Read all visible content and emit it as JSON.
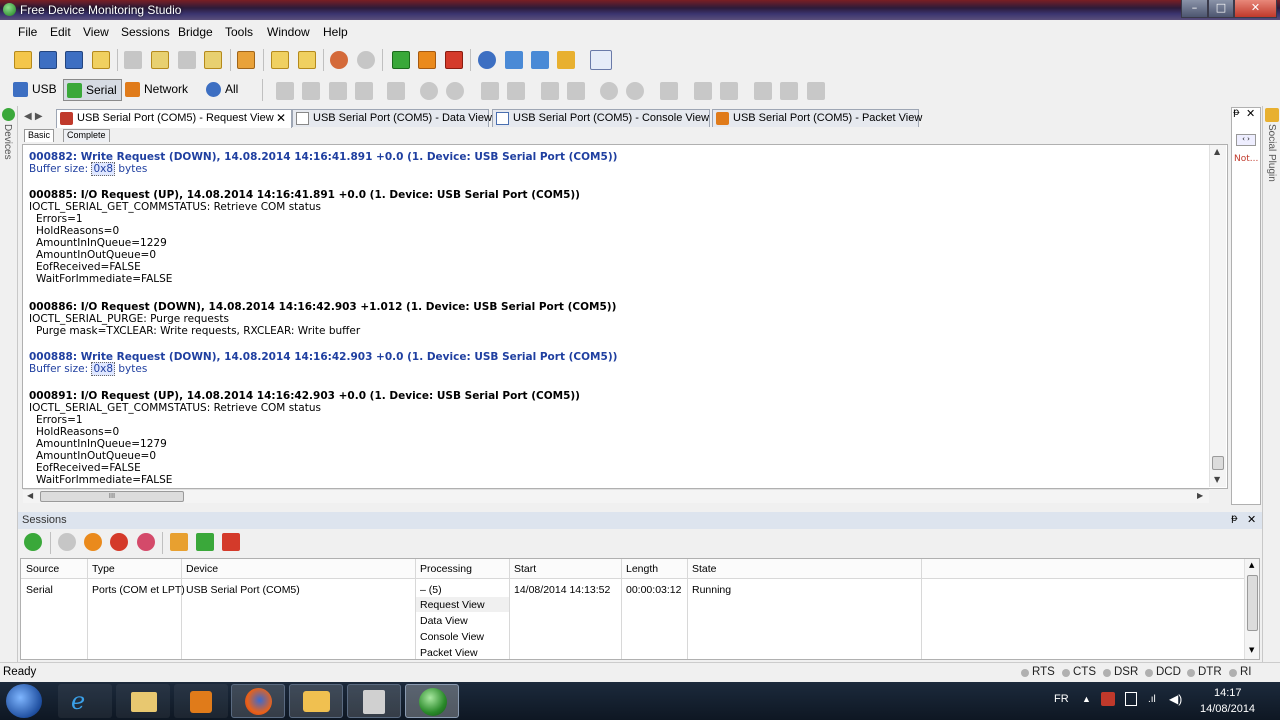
{
  "app": {
    "title": "Free Device Monitoring Studio"
  },
  "window_buttons": {
    "minimize": "–",
    "maximize": "□",
    "close": "✕"
  },
  "menu": [
    "File",
    "Edit",
    "View",
    "Sessions",
    "Bridge",
    "Tools",
    "Window",
    "Help"
  ],
  "toolbar2": {
    "usb": "USB",
    "serial": "Serial",
    "network": "Network",
    "all": "All"
  },
  "tabs": [
    {
      "label": "USB Serial Port (COM5) - Request View",
      "close": "✕"
    },
    {
      "label": "USB Serial Port (COM5) - Data View"
    },
    {
      "label": "USB Serial Port (COM5) - Console View"
    },
    {
      "label": "USB Serial Port (COM5) - Packet View"
    }
  ],
  "subtabs": [
    "Basic",
    "Complete"
  ],
  "side": {
    "devices": "Devices",
    "social": "Social Plugin",
    "right_note": "Not..."
  },
  "log": {
    "e1": {
      "header": "000882: Write Request (DOWN), 14.08.2014 14:16:41.891 +0.0 (1. Device: USB Serial Port (COM5))",
      "size_prefix": "Buffer size: ",
      "size_val": "0x8",
      "size_suffix": " bytes"
    },
    "e2": {
      "header": "000885: I/O Request (UP), 14.08.2014 14:16:41.891 +0.0 (1. Device: USB Serial Port (COM5))",
      "line": "IOCTL_SERIAL_GET_COMMSTATUS: Retrieve COM status",
      "params": [
        "Errors=1",
        "HoldReasons=0",
        "AmountInInQueue=1229",
        "AmountInOutQueue=0",
        "EofReceived=FALSE",
        "WaitForImmediate=FALSE"
      ]
    },
    "e3": {
      "header": "000886: I/O Request (DOWN), 14.08.2014 14:16:42.903 +1.012 (1. Device: USB Serial Port (COM5))",
      "line": "IOCTL_SERIAL_PURGE: Purge requests",
      "params": [
        "Purge mask=TXCLEAR: Write requests, RXCLEAR: Write buffer"
      ]
    },
    "e4": {
      "header": "000888: Write Request (DOWN), 14.08.2014 14:16:42.903 +0.0 (1. Device: USB Serial Port (COM5))",
      "size_prefix": "Buffer size: ",
      "size_val": "0x8",
      "size_suffix": " bytes"
    },
    "e5": {
      "header": "000891: I/O Request (UP), 14.08.2014 14:16:42.903 +0.0 (1. Device: USB Serial Port (COM5))",
      "line": "IOCTL_SERIAL_GET_COMMSTATUS: Retrieve COM status",
      "params": [
        "Errors=1",
        "HoldReasons=0",
        "AmountInInQueue=1279",
        "AmountInOutQueue=0",
        "EofReceived=FALSE",
        "WaitForImmediate=FALSE"
      ]
    }
  },
  "hscroll_grip": "III",
  "sessions": {
    "title": "Sessions",
    "columns": [
      "Source",
      "Type",
      "Device",
      "Processing",
      "Start",
      "Length",
      "State"
    ],
    "row": {
      "source": "Serial",
      "type": "Ports (COM et LPT)",
      "device": "USB Serial Port (COM5)",
      "processing": "– (5)",
      "start": "14/08/2014 14:13:52",
      "length": "00:00:03:12",
      "state": "Running"
    },
    "views": [
      "Request View",
      "Data View",
      "Console View",
      "Packet View"
    ]
  },
  "status": {
    "text": "Ready",
    "signals": [
      "RTS",
      "CTS",
      "DSR",
      "DCD",
      "DTR",
      "RI"
    ]
  },
  "taskbar": {
    "lang": "FR",
    "time": "14:17",
    "date": "14/08/2014"
  },
  "colors": {
    "link_blue": "#1f3fa0",
    "orange_tab": "#e07b1a"
  }
}
